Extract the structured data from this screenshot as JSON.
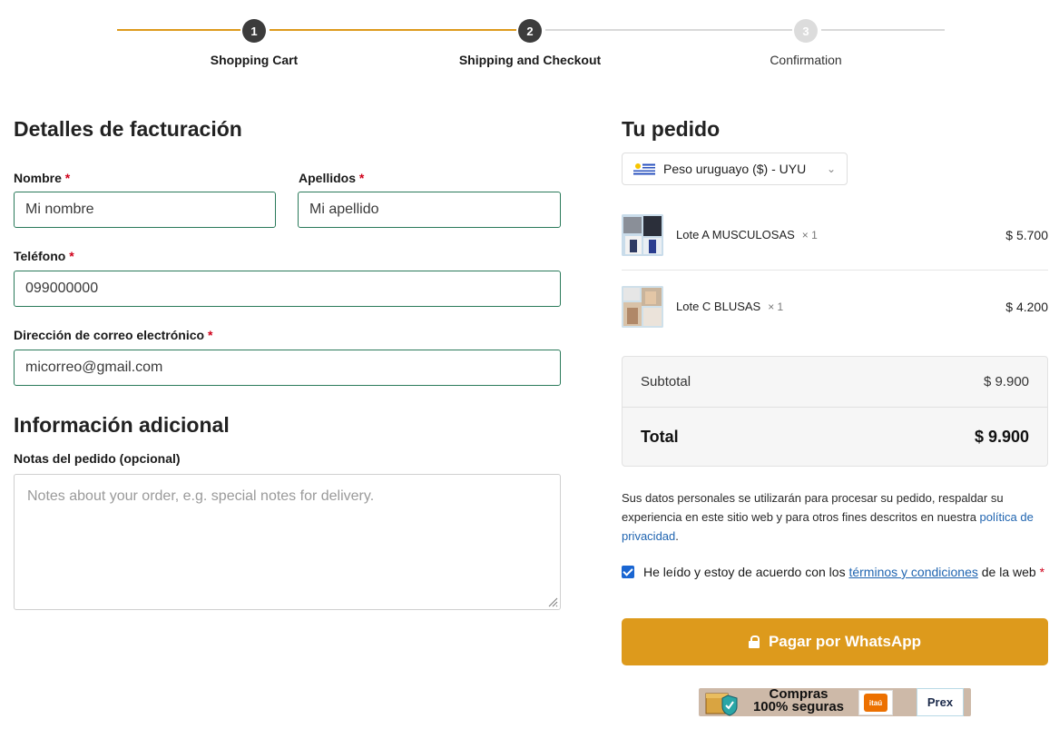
{
  "stepper": {
    "steps": [
      {
        "number": "1",
        "label": "Shopping Cart",
        "state": "done"
      },
      {
        "number": "2",
        "label": "Shipping and Checkout",
        "state": "current"
      },
      {
        "number": "3",
        "label": "Confirmation",
        "state": "todo"
      }
    ]
  },
  "billing": {
    "title": "Detalles de facturación",
    "required_mark": "*",
    "first_name": {
      "label": "Nombre",
      "value": "Mi nombre"
    },
    "last_name": {
      "label": "Apellidos",
      "value": "Mi apellido"
    },
    "phone": {
      "label": "Teléfono",
      "value": "099000000"
    },
    "email": {
      "label": "Dirección de correo electrónico",
      "value": "micorreo@gmail.com"
    }
  },
  "additional": {
    "title": "Información adicional",
    "notes_label": "Notas del pedido (opcional)",
    "notes_placeholder": "Notes about your order, e.g. special notes for delivery."
  },
  "order": {
    "title": "Tu pedido",
    "currency": "Peso uruguayo ($) - UYU",
    "items": [
      {
        "name": "Lote A MUSCULOSAS",
        "qty": "× 1",
        "price": "$ 5.700"
      },
      {
        "name": "Lote C BLUSAS",
        "qty": "× 1",
        "price": "$ 4.200"
      }
    ],
    "subtotal_label": "Subtotal",
    "subtotal_value": "$ 9.900",
    "total_label": "Total",
    "total_value": "$ 9.900"
  },
  "privacy": {
    "text": "Sus datos personales se utilizarán para procesar su pedido, respaldar su experiencia en este sitio web y para otros fines descritos en nuestra ",
    "link": "política de privacidad",
    "end": "."
  },
  "terms": {
    "checked": true,
    "text_before": "He leído y estoy de acuerdo con los ",
    "link": "términos y condiciones",
    "text_after": " de la web ",
    "required_mark": "*"
  },
  "pay_button": {
    "label": "Pagar por WhatsApp"
  },
  "trust_badge": {
    "line1": "Compras",
    "line2": "100% seguras",
    "bank1": "itaú",
    "bank2": "Prex"
  },
  "colors": {
    "accent": "#dd9a1c",
    "input_border": "#2a7a5a",
    "link": "#1f64b0",
    "required": "#d0021b"
  }
}
